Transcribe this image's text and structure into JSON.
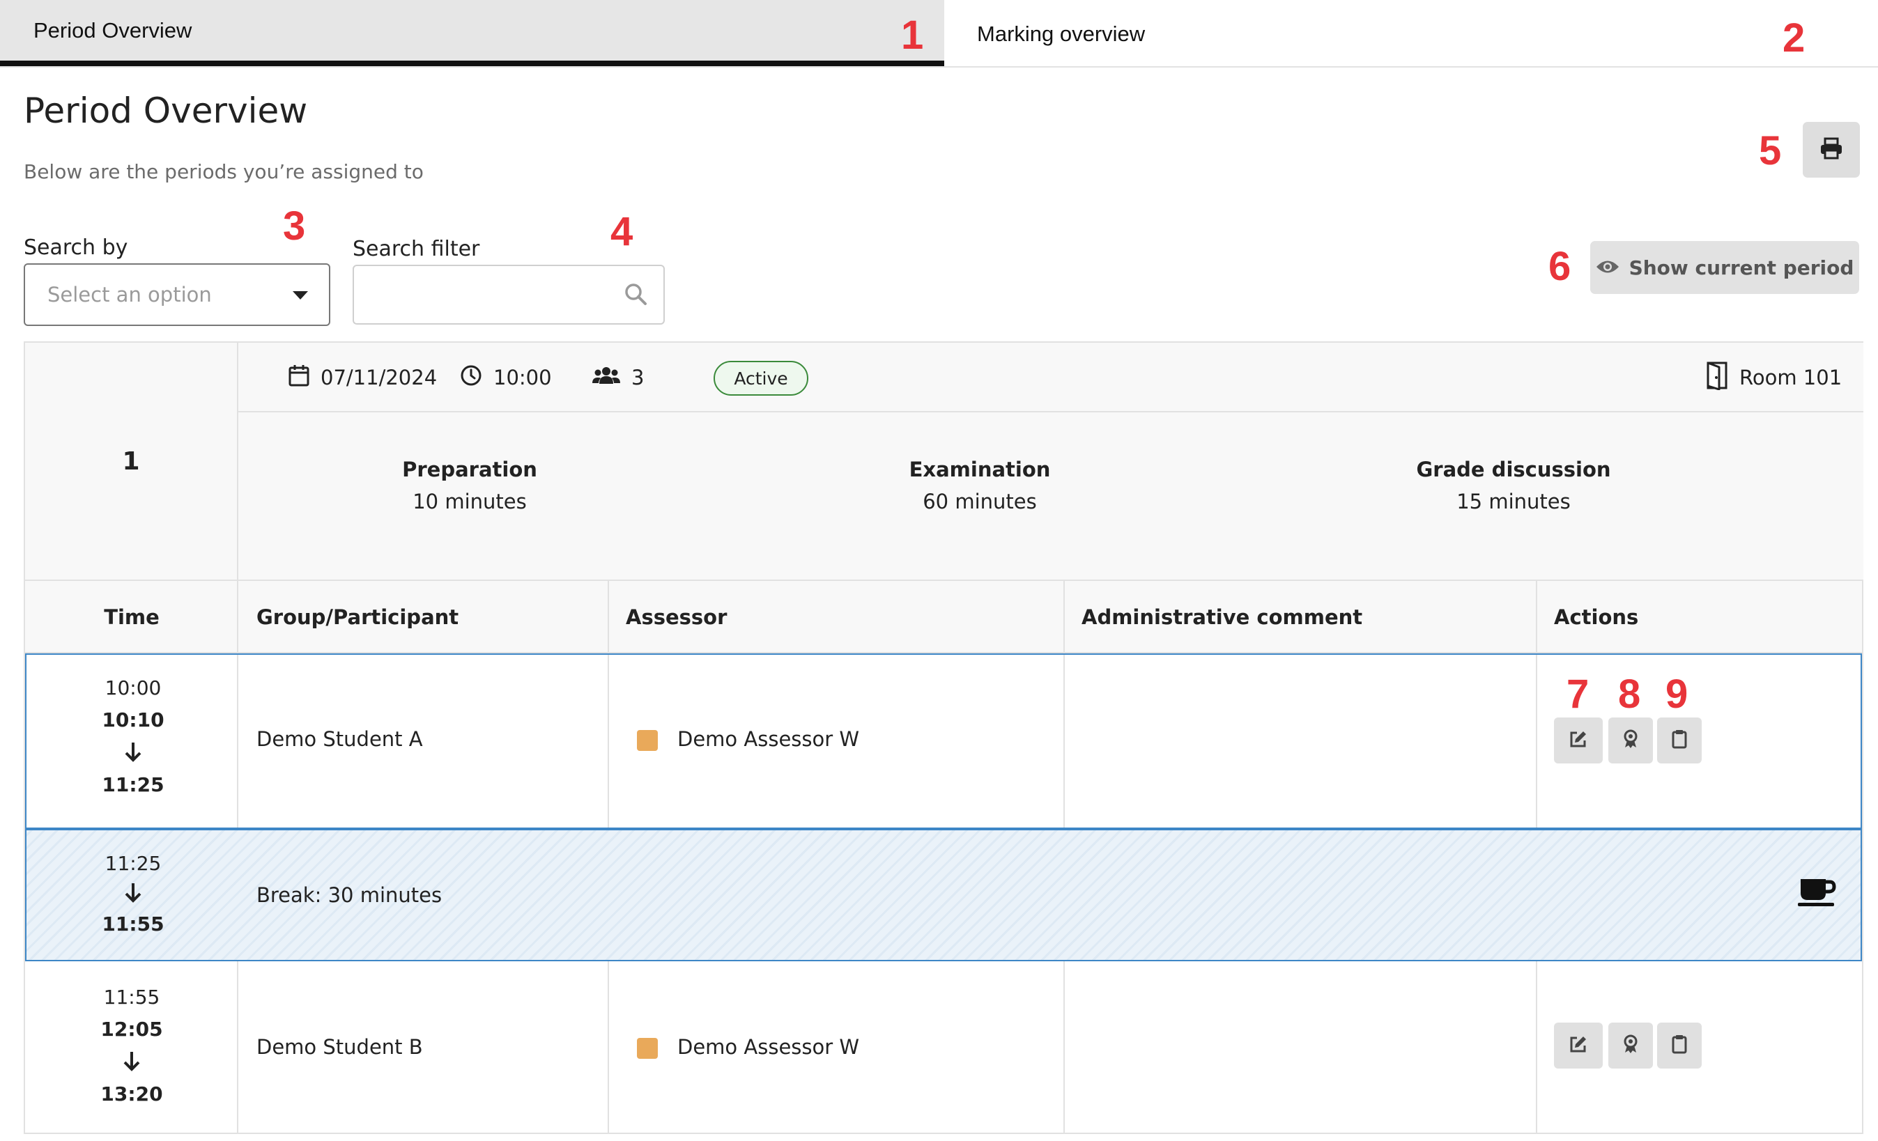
{
  "tabs": [
    {
      "label": "Period Overview",
      "marker": "1"
    },
    {
      "label": "Marking overview",
      "marker": "2"
    }
  ],
  "header": {
    "title": "Period Overview",
    "subtitle": "Below are the periods you’re assigned to",
    "print_marker": "5"
  },
  "filters": {
    "search_by_label": "Search by",
    "search_by_marker": "3",
    "search_by_placeholder": "Select an option",
    "search_filter_label": "Search filter",
    "search_filter_marker": "4",
    "search_filter_value": ""
  },
  "show_current": {
    "label": "Show current period",
    "marker": "6"
  },
  "period": {
    "number": "1",
    "date": "07/11/2024",
    "time": "10:00",
    "participants": "3",
    "status": "Active",
    "room": "Room 101",
    "phases": [
      {
        "name": "Preparation",
        "duration": "10 minutes"
      },
      {
        "name": "Examination",
        "duration": "60 minutes"
      },
      {
        "name": "Grade discussion",
        "duration": "15 minutes"
      }
    ]
  },
  "table": {
    "headers": [
      "Time",
      "Group/Participant",
      "Assessor",
      "Administrative comment",
      "Actions"
    ],
    "rows": [
      {
        "start": "10:00",
        "exam_start": "10:10",
        "end": "11:25",
        "participant": "Demo Student A",
        "assessor": "Demo Assessor W",
        "comment": ""
      },
      {
        "start": "11:55",
        "exam_start": "12:05",
        "end": "13:20",
        "participant": "Demo Student B",
        "assessor": "Demo Assessor W",
        "comment": ""
      }
    ],
    "break": {
      "start": "11:25",
      "end": "11:55",
      "label": "Break: 30 minutes"
    },
    "action_markers": [
      "7",
      "8",
      "9"
    ]
  },
  "colors": {
    "accent": "#3d86c6",
    "assessor": "#e9a95a",
    "marker": "#e8343a",
    "active_badge": "#3a8a3a"
  },
  "icons": [
    "print-icon",
    "search-icon",
    "eye-icon",
    "calendar-icon",
    "clock-icon",
    "users-icon",
    "door-icon",
    "edit-icon",
    "award-icon",
    "clipboard-icon",
    "coffee-icon",
    "arrow-down-icon"
  ]
}
